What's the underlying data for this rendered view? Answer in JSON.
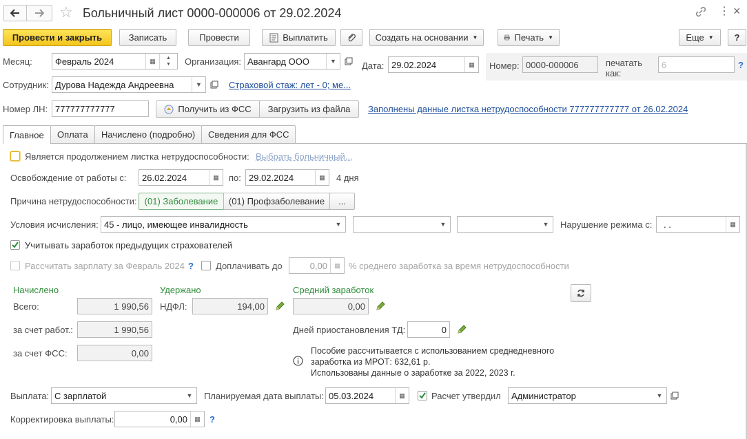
{
  "title": "Больничный лист 0000-000006 от 29.02.2024",
  "toolbar": {
    "post_close": "Провести и закрыть",
    "save": "Записать",
    "post": "Провести",
    "pay": "Выплатить",
    "create_based": "Создать на основании",
    "print": "Печать",
    "more": "Еще",
    "help": "?"
  },
  "header": {
    "month_label": "Месяц:",
    "month_value": "Февраль 2024",
    "org_label": "Организация:",
    "org_value": "Авангард ООО",
    "date_label": "Дата:",
    "date_value": "29.02.2024",
    "number_label": "Номер:",
    "number_value": "0000-000006",
    "print_as_label_1": "печатать",
    "print_as_label_2": "как:",
    "print_as_value": "6",
    "print_as_help": "?",
    "employee_label": "Сотрудник:",
    "employee_value": "Дурова Надежда Андреевна",
    "insurance_link": "Страховой стаж: лет - 0; ме...",
    "ln_label": "Номер ЛН:",
    "ln_value": "777777777777",
    "get_fss": "Получить из ФСС",
    "load_file": "Загрузить из файла",
    "filled_link": "Заполнены данные листка нетрудоспособности 777777777777 от 26.02.2024"
  },
  "tabs": [
    "Главное",
    "Оплата",
    "Начислено (подробно)",
    "Сведения для ФСС"
  ],
  "main": {
    "continuation_label": "Является продолжением листка нетрудоспособности:",
    "choose_sick_link": "Выбрать больничный...",
    "release_label": "Освобождение от работы с:",
    "release_from": "26.02.2024",
    "release_to_label": "по:",
    "release_to": "29.02.2024",
    "days": "4 дня",
    "cause_label": "Причина нетрудоспособности:",
    "cause_1": "(01) Заболевание",
    "cause_2": "(01) Профзаболевание",
    "cause_more": "...",
    "conditions_label": "Условия исчисления:",
    "conditions_value": "45 - лицо, имеющее инвалидность",
    "violation_label": "Нарушение режима с:",
    "violation_value": " .  .",
    "prev_employers_label": "Учитывать заработок предыдущих страхователей",
    "calc_salary_label": "Рассчитать зарплату за Февраль 2024",
    "calc_help": "?",
    "topup_label": "Доплачивать до",
    "topup_value": "0,00",
    "topup_suffix": "% среднего заработка за время нетрудоспособности"
  },
  "amounts": {
    "accrued_header": "Начислено",
    "withheld_header": "Удержано",
    "avg_header": "Средний заработок",
    "total_label": "Всего:",
    "total_value": "1 990,56",
    "ndfl_label": "НДФЛ:",
    "ndfl_value": "194,00",
    "avg_value": "0,00",
    "employer_label": "за счет работ.:",
    "employer_value": "1 990,56",
    "suspension_label": "Дней приостановления ТД:",
    "suspension_value": "0",
    "fss_label": "за счет ФСС:",
    "fss_value": "0,00",
    "info_1": "Пособие рассчитывается с использованием среднедневного",
    "info_2": "заработка из МРОТ: 632,61 р.",
    "info_3": "Использованы данные о заработке за  2022,  2023 г."
  },
  "footer": {
    "payout_label": "Выплата:",
    "payout_value": "С зарплатой",
    "planned_label": "Планируемая дата выплаты:",
    "planned_value": "05.03.2024",
    "approved_label": "Расчет утвердил",
    "approved_value": "Администратор",
    "adjust_label": "Корректировка выплаты:",
    "adjust_value": "0,00",
    "adjust_help": "?"
  }
}
